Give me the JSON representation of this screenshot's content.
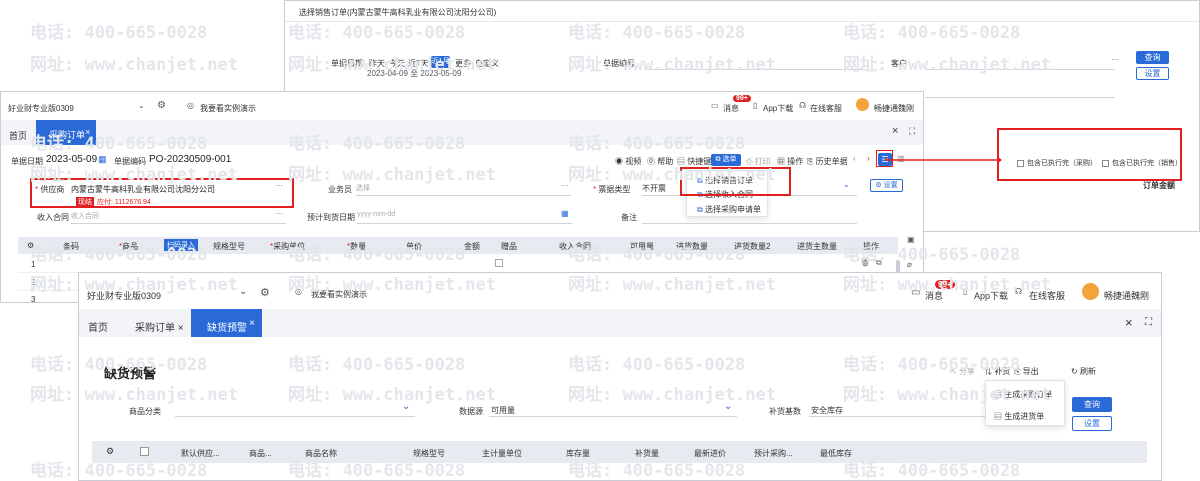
{
  "w1": {
    "title": "选择销售订单(内蒙古蒙牛高科乳业有限公司沈阳分公司)",
    "date_label": "单据日期",
    "date_options": [
      "昨天",
      "今天",
      "近7天",
      "近1月",
      "更多",
      "自定义"
    ],
    "date_active": "近1月",
    "date_range": "2023-04-09 至 2023-05-09",
    "code_label": "单据编号",
    "customer_label": "客户",
    "query_btn": "查询",
    "settings_btn": "设置",
    "total_amount": "订单金额"
  },
  "popup": {
    "opt1": "包含已执行完（采购）",
    "opt2": "包含已执行完（销售）"
  },
  "w2": {
    "company": "好业财专业版0309",
    "demo_link": "我要看实例演示",
    "msg_label": "消息",
    "msg_badge": "99+",
    "app_download": "App下载",
    "online_service": "在线客服",
    "user": "畅捷通魏刚",
    "tabs": [
      "首页",
      "采购订单"
    ],
    "tab_close": "×",
    "date_label": "单据日期",
    "date_value": "2023-05-09",
    "code_label": "单据编码",
    "code_value": "PO-20230509-001",
    "toolbar": {
      "video": "视频",
      "help": "帮助",
      "shortcut": "快捷键",
      "choose": "选单",
      "print": "打印",
      "operate": "操作",
      "history": "历史单据"
    },
    "choose_menu": [
      "选择销售订单",
      "选择收入合同",
      "选择采购申请单"
    ],
    "supplier_label": "供应商",
    "supplier_value": "内蒙古蒙牛高科乳业有限公司沈阳分公司",
    "cash_tag": "现结",
    "payable": "应付: 1112676.94",
    "salesman_label": "业务员",
    "salesman_placeholder": "选择",
    "invoice_type_label": "票据类型",
    "invoice_type_value": "不开票",
    "settings_btn": "设置",
    "income_contract_label": "收入合同",
    "income_contract_placeholder": "收入合同",
    "arrival_date_label": "预计到货日期",
    "arrival_date_placeholder": "yyyy-mm-dd",
    "remark_label": "备注",
    "columns": [
      "条码",
      "商品",
      "扫码录入",
      "规格型号",
      "采购单位",
      "数量",
      "单价",
      "金额",
      "赠品",
      "收入合同",
      "可用量",
      "进货数量",
      "进货数量2",
      "进货主数量",
      "操作"
    ],
    "rows": [
      "1",
      "2",
      "3"
    ]
  },
  "w3": {
    "company": "好业财专业版0309",
    "demo_link": "我要看实例演示",
    "msg_label": "消息",
    "msg_badge": "99+",
    "app_download": "App下载",
    "online_service": "在线客服",
    "user": "畅捷通魏刚",
    "tabs": [
      "首页",
      "采购订单",
      "缺货预警"
    ],
    "tab_close": "×",
    "page_title": "缺货预警",
    "actions": {
      "share": "分享",
      "replenish": "补货",
      "export": "导出",
      "refresh": "刷新"
    },
    "replenish_menu": [
      "生成采购订单",
      "生成进货单"
    ],
    "category_label": "商品分类",
    "datasource_label": "数据源",
    "datasource_value": "可用量",
    "base_label": "补货基数",
    "base_value": "安全库存",
    "query_btn": "查询",
    "settings_btn": "设置",
    "columns": [
      "默认供应...",
      "商品...",
      "商品名称",
      "规格型号",
      "主计量单位",
      "库存量",
      "补货量",
      "最新进价",
      "预计采购...",
      "最低库存"
    ]
  },
  "watermarks": {
    "phone": "电话: 400-665-0028",
    "site": "网址: www.chanjet.net"
  },
  "colors": {
    "primary": "#2a6ad8",
    "highlight": "#e02020",
    "header_bg": "#e7eaf0"
  }
}
